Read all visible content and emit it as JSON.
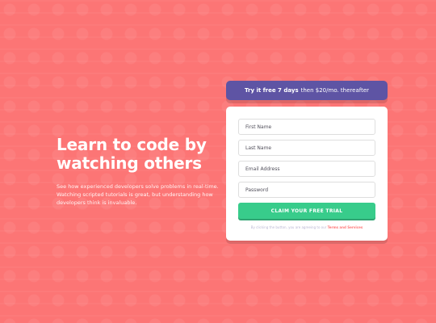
{
  "hero": {
    "title": "Learn to code by watching others",
    "description": "See how experienced developers solve problems in real-time. Watching scripted tutorials is great, but understanding how developers think is invaluable."
  },
  "promo": {
    "bold": "Try it free 7 days",
    "rest": "then $20/mo. thereafter"
  },
  "form": {
    "first_name": {
      "placeholder": "First Name",
      "value": ""
    },
    "last_name": {
      "placeholder": "Last Name",
      "value": ""
    },
    "email": {
      "placeholder": "Email Address",
      "value": ""
    },
    "password": {
      "placeholder": "Password",
      "value": ""
    },
    "submit_label": "CLAIM YOUR FREE TRIAL",
    "terms_prefix": "By clicking the button, you are agreeing to our",
    "terms_link": "Terms and Services"
  },
  "colors": {
    "background": "#fa7a7a",
    "promo": "#5e54a4",
    "cta": "#38cc8b",
    "link": "#ff7979"
  }
}
